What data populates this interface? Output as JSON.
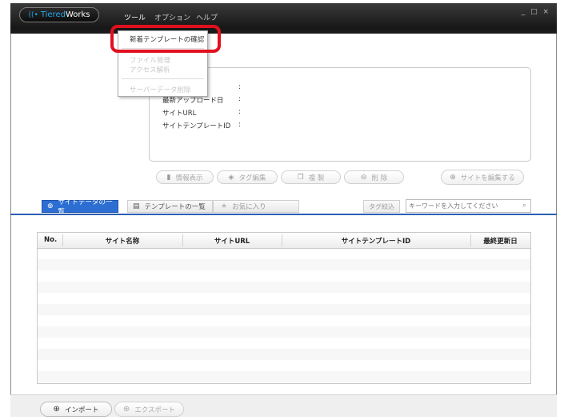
{
  "app": {
    "logo_wifi_icon": "wifi-icon",
    "brand_part1": "Tiered",
    "brand_part2": "Works",
    "menu": [
      "ツール",
      "オプション",
      "ヘルプ"
    ],
    "window_controls": "_ □ ×"
  },
  "dropdown": {
    "items": [
      {
        "label": "新着テンプレートの確認",
        "enabled": true
      },
      {
        "label": "ファイル管理",
        "enabled": false
      },
      {
        "label": "アクセス解析",
        "enabled": false
      },
      {
        "label": "サーバーデータ削除",
        "enabled": false
      }
    ]
  },
  "info": {
    "fields": [
      {
        "label": "最新アップロード日",
        "colon": ":"
      },
      {
        "label": "サイトURL",
        "colon": ":"
      },
      {
        "label": "サイトテンプレートID",
        "colon": ":"
      }
    ],
    "extra_colon": ":"
  },
  "actions": {
    "info": "情報表示",
    "tag_edit": "タグ編集",
    "copy": "複 製",
    "delete": "削 除",
    "edit_site": "サイトを編集する"
  },
  "tabs": {
    "site_list": "サイトデータの一覧",
    "template_list": "テンプレートの一覧",
    "favorites": "お気に入り",
    "tag_filter": "タグ絞込",
    "search_placeholder": "キーワードを入力してください"
  },
  "table": {
    "columns": [
      "No.",
      "サイト名称",
      "サイトURL",
      "サイトテンプレートID",
      "最終更新日"
    ],
    "rows": []
  },
  "footer": {
    "import": "インポート",
    "export": "エクスポート"
  },
  "colors": {
    "accent_blue": "#2d6ed3",
    "highlight_red": "#e0101e",
    "titlebar": "#1b1b1b"
  }
}
